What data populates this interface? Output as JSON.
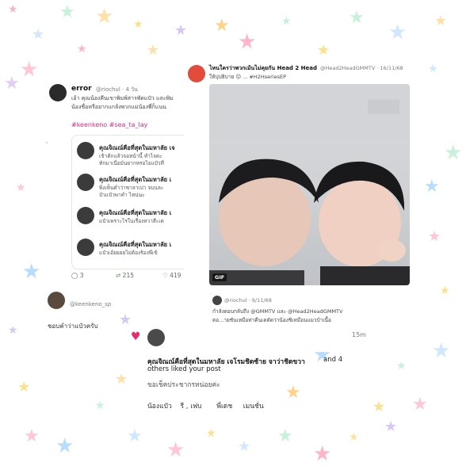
{
  "left_tweet": {
    "name": "error",
    "handle": "@riochul · 4 วัน",
    "text_line1": "เอ้า คุณน้องคีนเขาพิมพ์สารพัดแป๋ว และพิม",
    "text_line2": "น้องชื่อหรือยากแกล้งพวกแม่น้องพี่ก็แนน",
    "hashtags": "#keenkeno #sea_ta_lay",
    "quotes": [
      {
        "name": "คุณจิณณ์คือที่สุดในมหาลัย เจ",
        "text_a": "เข้าต้กแล้วจอหน้านี้ ทำไจตะ",
        "text_b": "ทักมาเนี่ยมันยากหรอไอแป๋วที่"
      },
      {
        "name": "คุณจิณณ์คือที่สุดในมหาลัย เ",
        "text_a": "พิ่งเห็นคำว่าซาลาเปา จบนละ",
        "text_b": "ป๋วแป๋วพาคำ ไหน่นะ"
      },
      {
        "name": "คุณจิณณ์คือที่สุดในมหาลัย เ",
        "text_a": "แป๋วเพราะไรในเรื่องหวาสีะเค",
        "text_b": ""
      },
      {
        "name": "คุณจิณณ์คือที่สุดในมหาลัย เ",
        "text_a": "แป๋วเอ้ยยยยไม่ต้องร้องพี่เข้",
        "text_b": ""
      }
    ],
    "replies": "3",
    "retweets": "215",
    "likes": "419"
  },
  "mention": {
    "handle": "@keenkeno_sp",
    "text": "ชอบคำว่าแป๋วครับ"
  },
  "right_tweet": {
    "title": "ไหนใครว่าพวกเม้นไม่คุยกัน Head 2 Head",
    "handle": "@Head2HeadGMMTV · 16/11/68",
    "line2": "ให้ปุปธิบาย 😖 ... #H2HseriesEP",
    "gif_label": "GIF",
    "reply_handle": "@riochul · 9/11/68",
    "reply_text1": "กำลังตอบกลับถึง @GMMTV และ @Head2HeadGMMTV",
    "reply_text2": "ตอ...ายชันเหมือท่าคีนเคตัดว่าน้องชิเหมือนแมวบ้าเนื้อ",
    "time": "15m"
  },
  "notification": {
    "text": "คุณจิณณ์คือที่สุดในมหาลัย เจโรมชิดซ้าย จาว่าชิดขวา",
    "suffix": "and 4",
    "line2": "others liked your post",
    "line3": "ขอเช็คประชากรหน่อยค่ะ",
    "footer": "น้องแป๋ว    รี , เฟบ       พี่เดช     เมนชั่น"
  },
  "colors": {
    "accent_pink": "#e0287a",
    "link_blue": "#3a6fd8",
    "heart": "#ea2a6f"
  }
}
